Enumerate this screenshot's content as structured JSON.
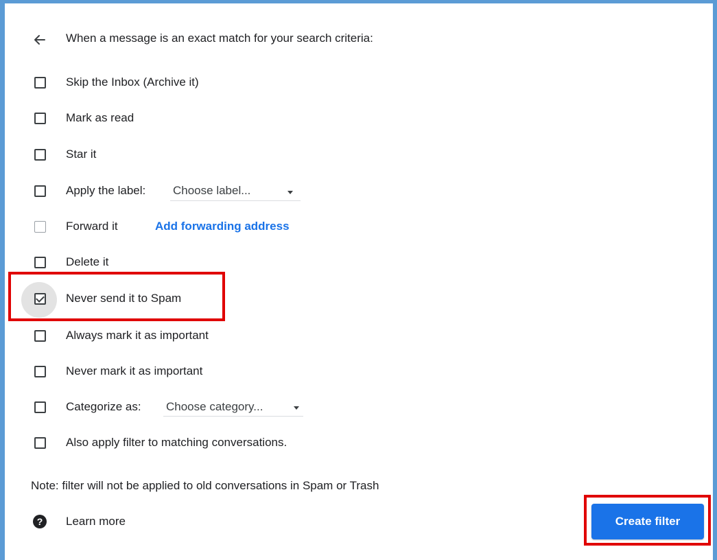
{
  "header": {
    "title": "When a message is an exact match for your search criteria:"
  },
  "options": [
    {
      "label": "Skip the Inbox (Archive it)",
      "checked": false
    },
    {
      "label": "Mark as read",
      "checked": false
    },
    {
      "label": "Star it",
      "checked": false
    },
    {
      "label": "Apply the label:",
      "select_value": "Choose label...",
      "checked": false
    },
    {
      "label": "Forward it",
      "link": "Add forwarding address",
      "checked": false,
      "disabled": true
    },
    {
      "label": "Delete it",
      "checked": false
    },
    {
      "label": "Never send it to Spam",
      "checked": true
    },
    {
      "label": "Always mark it as important",
      "checked": false
    },
    {
      "label": "Never mark it as important",
      "checked": false
    },
    {
      "label": "Categorize as:",
      "select_value": "Choose category...",
      "checked": false
    },
    {
      "label": "Also apply filter to matching conversations.",
      "checked": false
    }
  ],
  "note": "Note: filter will not be applied to old conversations in Spam or Trash",
  "footer": {
    "learn_more": "Learn more",
    "create_filter": "Create filter"
  },
  "colors": {
    "accent": "#1a73e8",
    "highlight": "#e00000",
    "frame": "#5b9bd5"
  }
}
